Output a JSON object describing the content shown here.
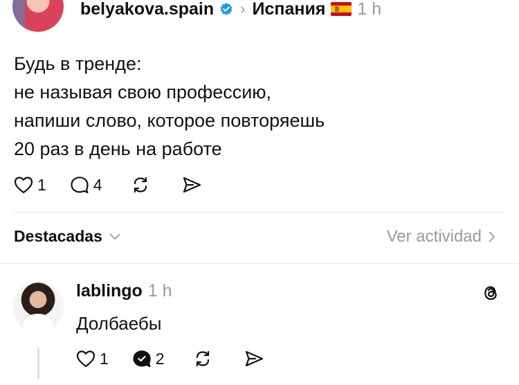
{
  "post": {
    "username": "belyakova.spain",
    "community": "Испания",
    "time": "1 h",
    "lines": [
      "Будь в тренде:",
      "не называя свою профессию,",
      "напиши слово, которое повторяешь",
      "20 раз в день на работе"
    ],
    "likes": "1",
    "comments": "4"
  },
  "highlights": {
    "label": "Destacadas",
    "activity": "Ver actividad"
  },
  "reply": {
    "username": "lablingo",
    "time": "1 h",
    "text": "Долбаебы",
    "likes": "1",
    "comments": "2"
  },
  "colors": {
    "text": "#111111",
    "muted": "#9a9a9a",
    "verified": "#1d9bf0",
    "divider": "#e6e6e6"
  }
}
